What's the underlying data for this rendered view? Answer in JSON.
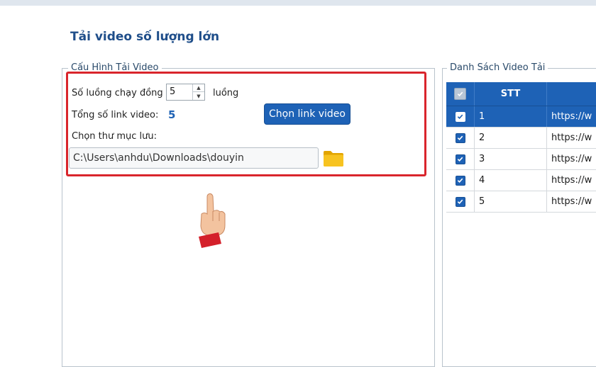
{
  "page": {
    "title": "Tải video số lượng lớn"
  },
  "config": {
    "legend": "Cấu Hình Tải Video",
    "threads_label": "Số luồng chạy đồng t",
    "threads_value": "5",
    "threads_unit": "luồng",
    "total_links_label": "Tổng số link video:",
    "total_links_value": "5",
    "choose_button": "Chọn link video",
    "folder_label": "Chọn thư mục lưu:",
    "folder_path": "C:\\Users\\anhdu\\Downloads\\douyin"
  },
  "list": {
    "legend": "Danh Sách Video Tải",
    "columns": [
      "",
      "STT",
      ""
    ],
    "rows": [
      {
        "stt": "1",
        "url": "https://w",
        "checked": true,
        "selected": true
      },
      {
        "stt": "2",
        "url": "https://w",
        "checked": true,
        "selected": false
      },
      {
        "stt": "3",
        "url": "https://w",
        "checked": true,
        "selected": false
      },
      {
        "stt": "4",
        "url": "https://w",
        "checked": true,
        "selected": false
      },
      {
        "stt": "5",
        "url": "https://w",
        "checked": true,
        "selected": false
      }
    ]
  },
  "icons": {
    "folder": "folder-icon",
    "pointer": "pointing-hand-icon",
    "check": "checkmark-icon"
  },
  "colors": {
    "accent": "#1e62b6",
    "title": "#1f4e8a",
    "highlight": "#d9252c",
    "folder": "#f5b800"
  }
}
